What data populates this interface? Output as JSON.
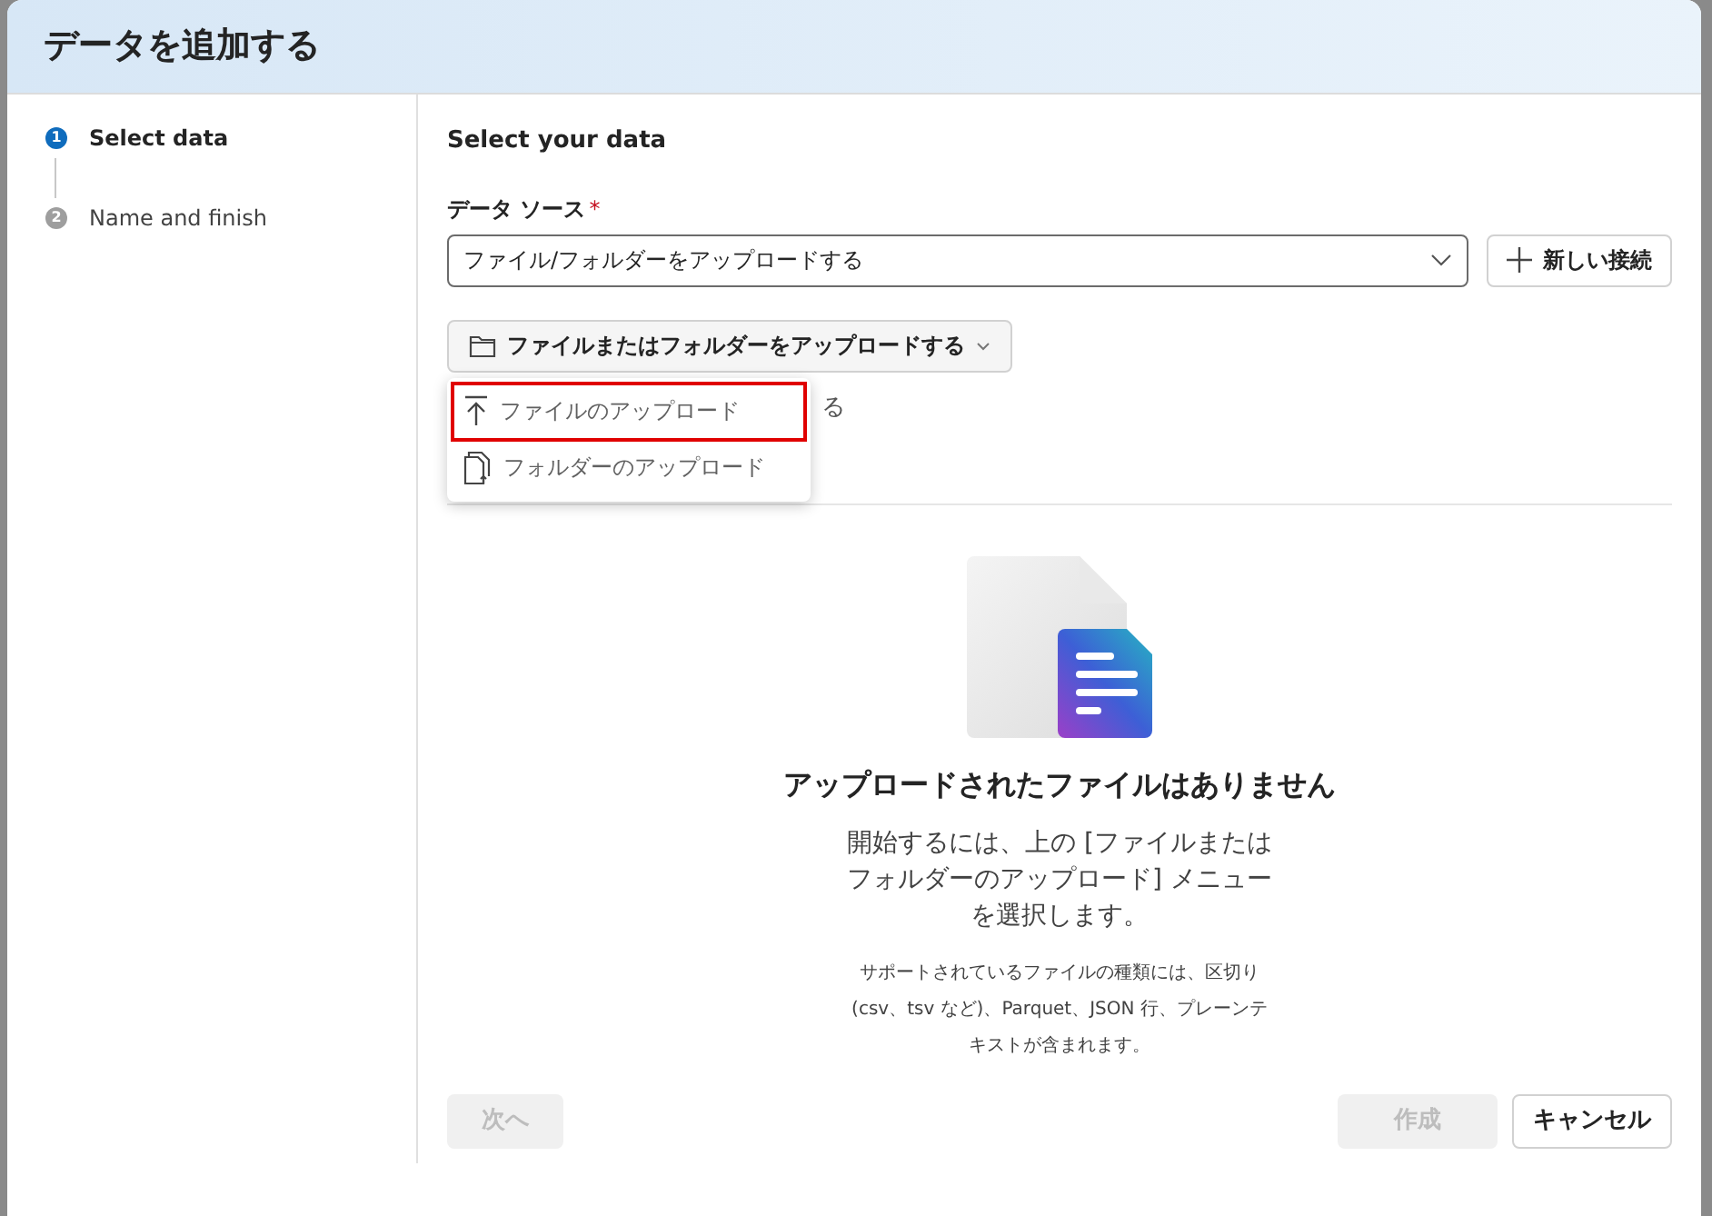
{
  "dialog": {
    "title": "データを追加する"
  },
  "steps": [
    {
      "number": "1",
      "label": "Select data",
      "current": true
    },
    {
      "number": "2",
      "label": "Name and finish",
      "current": false
    }
  ],
  "section_title": "Select your data",
  "data_source": {
    "label": "データ ソース",
    "required_mark": "*",
    "value": "ファイル/フォルダーをアップロードする",
    "new_connection": "新しい接続"
  },
  "upload_menu": {
    "label": "ファイルまたはフォルダーをアップロードする",
    "expanded": true,
    "covered_text": "る",
    "items": [
      {
        "kind": "file",
        "label": "ファイルのアップロード",
        "highlighted": true
      },
      {
        "kind": "folder",
        "label": "フォルダーのアップロード",
        "highlighted": false
      }
    ]
  },
  "empty_state": {
    "title": "アップロードされたファイルはありません",
    "message": "開始するには、上の [ファイルまたはフォルダーのアップロード] メニューを選択します。",
    "note": "サポートされているファイルの種類には、区切り (csv、tsv など)、Parquet、JSON 行、プレーンテキストが含まれます。"
  },
  "footer": {
    "next": {
      "label": "次へ",
      "disabled": true
    },
    "create": {
      "label": "作成",
      "disabled": true
    },
    "cancel": {
      "label": "キャンセル",
      "disabled": false
    }
  }
}
